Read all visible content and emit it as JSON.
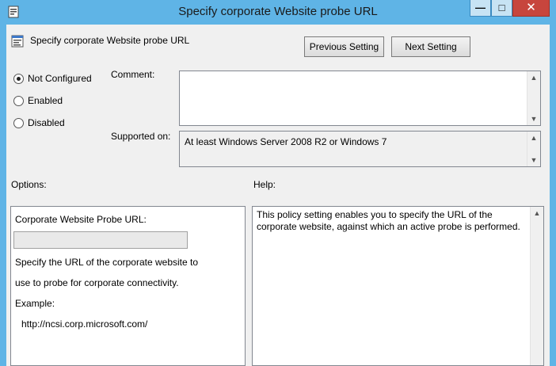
{
  "window": {
    "title": "Specify corporate Website probe URL",
    "controls": {
      "minimize": "—",
      "maximize": "□",
      "close": "✕"
    }
  },
  "header": {
    "setting_name": "Specify corporate Website probe URL",
    "previous_label": "Previous Setting",
    "next_label": "Next Setting"
  },
  "state": {
    "options": [
      {
        "label": "Not Configured",
        "checked": true
      },
      {
        "label": "Enabled",
        "checked": false
      },
      {
        "label": "Disabled",
        "checked": false
      }
    ]
  },
  "comment": {
    "label": "Comment:",
    "value": ""
  },
  "supported": {
    "label": "Supported on:",
    "value": "At least Windows Server 2008 R2 or Windows 7"
  },
  "options_pane": {
    "label": "Options:",
    "field_label": "Corporate Website Probe URL:",
    "field_value": "",
    "desc_line1": "Specify the URL of the corporate website to",
    "desc_line2": "use to probe for corporate connectivity.",
    "example_label": "Example:",
    "example_url": "http://ncsi.corp.microsoft.com/"
  },
  "help_pane": {
    "label": "Help:",
    "text": "This policy setting enables you to specify the URL of the corporate website, against which an active probe is performed."
  },
  "scroll_arrows": {
    "up": "▲",
    "down": "▼"
  }
}
